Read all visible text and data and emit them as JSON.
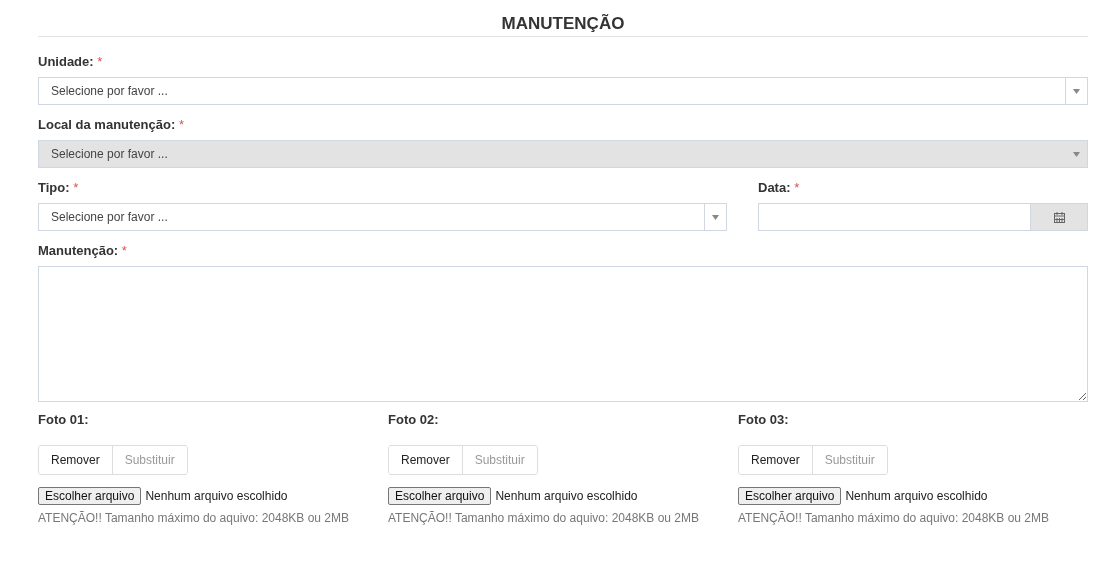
{
  "title": "MANUTENÇÃO",
  "rows": [
    {
      "fields": [
        {
          "kind": "select",
          "label": "Unidade:",
          "required_mark": "*",
          "placeholder": "Selecione por favor ...",
          "disabled": false
        }
      ]
    },
    {
      "fields": [
        {
          "kind": "select",
          "label": "Local da manutenção:",
          "required_mark": "*",
          "placeholder": "Selecione por favor ...",
          "disabled": true
        }
      ]
    },
    {
      "fields": [
        {
          "kind": "select",
          "label": "Tipo:",
          "required_mark": "*",
          "placeholder": "Selecione por favor ...",
          "disabled": false
        },
        {
          "kind": "date",
          "label": "Data:",
          "required_mark": "*"
        }
      ]
    },
    {
      "fields": [
        {
          "kind": "textarea",
          "label": "Manutenção:",
          "required_mark": "*"
        }
      ]
    }
  ],
  "photos": [
    {
      "label": "Foto 01:",
      "buttons": [
        {
          "label": "Remover",
          "disabled": false
        },
        {
          "label": "Substituir",
          "disabled": true
        }
      ],
      "file_button": "Escolher arquivo",
      "file_status": "Nenhum arquivo escolhido",
      "note": "ATENÇÃO!! Tamanho máximo do aquivo: 2048KB ou 2MB"
    },
    {
      "label": "Foto 02:",
      "buttons": [
        {
          "label": "Remover",
          "disabled": false
        },
        {
          "label": "Substituir",
          "disabled": true
        }
      ],
      "file_button": "Escolher arquivo",
      "file_status": "Nenhum arquivo escolhido",
      "note": "ATENÇÃO!! Tamanho máximo do aquivo: 2048KB ou 2MB"
    },
    {
      "label": "Foto 03:",
      "buttons": [
        {
          "label": "Remover",
          "disabled": false
        },
        {
          "label": "Substituir",
          "disabled": true
        }
      ],
      "file_button": "Escolher arquivo",
      "file_status": "Nenhum arquivo escolhido",
      "note": "ATENÇÃO!! Tamanho máximo do aquivo: 2048KB ou 2MB"
    }
  ]
}
